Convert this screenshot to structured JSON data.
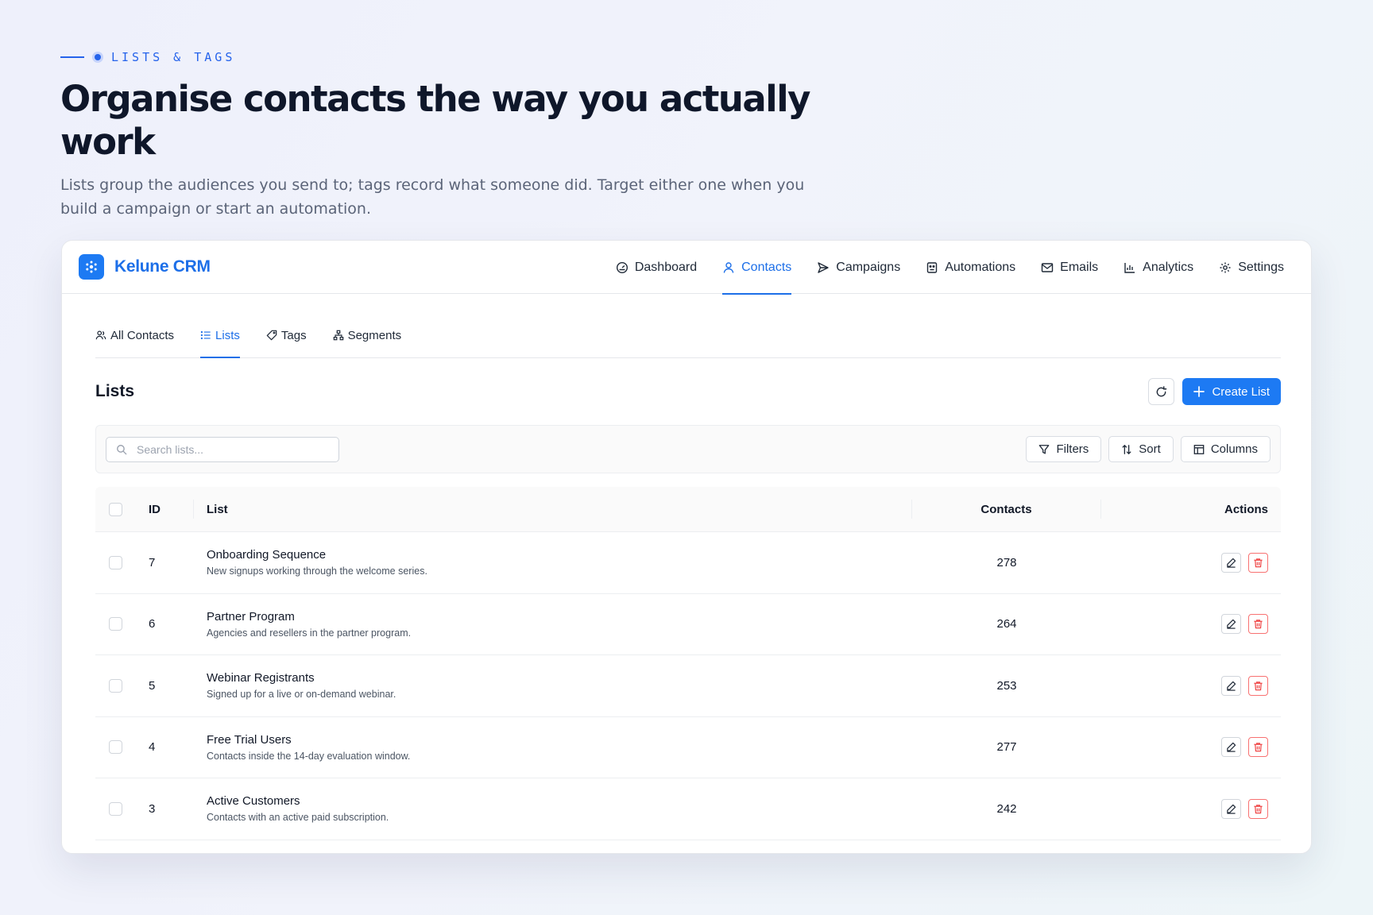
{
  "hero": {
    "eyebrow": "LISTS & TAGS",
    "title": "Organise contacts the way you actually work",
    "subtitle": "Lists group the audiences you send to; tags record what someone did. Target either one when you build a campaign or start an automation."
  },
  "app": {
    "brand": "Kelune CRM",
    "nav": [
      {
        "label": "Dashboard",
        "icon": "gauge-icon"
      },
      {
        "label": "Contacts",
        "icon": "user-icon",
        "active": true
      },
      {
        "label": "Campaigns",
        "icon": "send-icon"
      },
      {
        "label": "Automations",
        "icon": "robot-icon"
      },
      {
        "label": "Emails",
        "icon": "mail-icon"
      },
      {
        "label": "Analytics",
        "icon": "bar-chart-icon"
      },
      {
        "label": "Settings",
        "icon": "gear-icon"
      }
    ],
    "subtabs": [
      {
        "label": "All Contacts",
        "icon": "users-icon"
      },
      {
        "label": "Lists",
        "icon": "list-icon",
        "active": true
      },
      {
        "label": "Tags",
        "icon": "tag-icon"
      },
      {
        "label": "Segments",
        "icon": "sitemap-icon"
      }
    ],
    "page_title": "Lists",
    "create_label": "Create List",
    "search_placeholder": "Search lists...",
    "toolbar": {
      "filters": "Filters",
      "sort": "Sort",
      "columns": "Columns"
    },
    "table": {
      "headers": {
        "id": "ID",
        "list": "List",
        "contacts": "Contacts",
        "actions": "Actions"
      },
      "rows": [
        {
          "id": "7",
          "name": "Onboarding Sequence",
          "desc": "New signups working through the welcome series.",
          "contacts": "278"
        },
        {
          "id": "6",
          "name": "Partner Program",
          "desc": "Agencies and resellers in the partner program.",
          "contacts": "264"
        },
        {
          "id": "5",
          "name": "Webinar Registrants",
          "desc": "Signed up for a live or on-demand webinar.",
          "contacts": "253"
        },
        {
          "id": "4",
          "name": "Free Trial Users",
          "desc": "Contacts inside the 14-day evaluation window.",
          "contacts": "277"
        },
        {
          "id": "3",
          "name": "Active Customers",
          "desc": "Contacts with an active paid subscription.",
          "contacts": "242"
        }
      ]
    }
  },
  "colors": {
    "accent": "#1d7af3",
    "danger": "#ef4444",
    "heading": "#0f172a"
  }
}
